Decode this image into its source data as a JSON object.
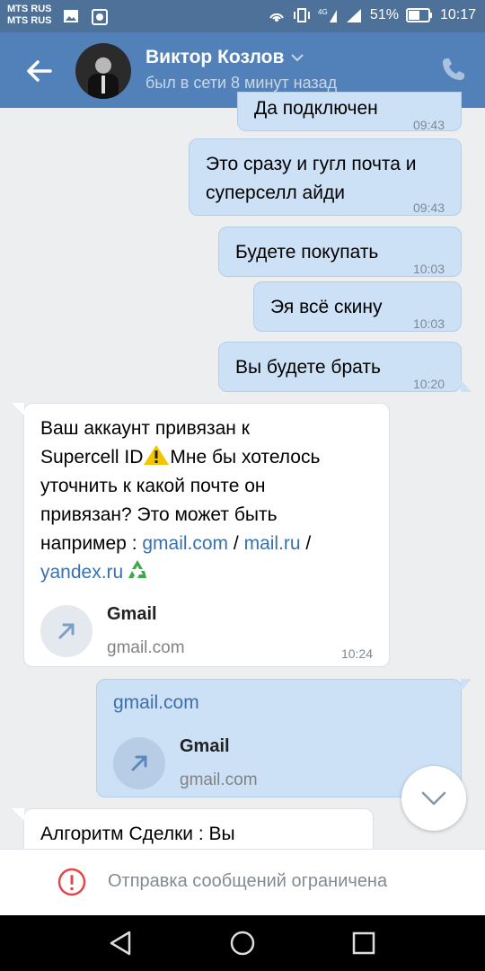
{
  "statusbar": {
    "carrier1": "MTS RUS",
    "carrier2": "MTS RUS",
    "battery": "51%",
    "time": "10:17"
  },
  "header": {
    "name": "Виктор Козлов",
    "status": "был в сети 8 минут назад"
  },
  "messages": [
    {
      "text": "Да подключен",
      "time": "09:43"
    },
    {
      "text1": "Это сразу и гугл почта и",
      "text2": "суперселл айди",
      "time": "09:43"
    },
    {
      "text": "Будете покупать",
      "time": "10:03"
    },
    {
      "text": "Эя всё скину",
      "time": "10:03"
    },
    {
      "text": "Вы будете брать",
      "time": "10:20"
    }
  ],
  "incoming1": {
    "line1": "Ваш аккаунт привязан к",
    "line2a": "Supercell ID",
    "line2b": "Мне бы хотелось",
    "line3": "уточнить к какой почте он",
    "line4": "привязан? Это может быть",
    "line5a": "например : ",
    "link1": "gmail.com",
    "sep1": " / ",
    "link2": "mail.ru",
    "sep2": " /",
    "link3": "yandex.ru",
    "attach_title": "Gmail",
    "attach_sub": "gmail.com",
    "time": "10:24"
  },
  "outgoing_link": {
    "text": "gmail.com",
    "attach_title": "Gmail",
    "attach_sub": "gmail.com"
  },
  "incoming2": {
    "text": "Алгоритм Сделки : Вы"
  },
  "bottom": {
    "restricted": "Отправка сообщений ограничена"
  },
  "colors": {
    "header": "#5181b8",
    "statusbar": "#4d7198",
    "outgoing": "#cce0f6",
    "link": "#3a70ad"
  }
}
